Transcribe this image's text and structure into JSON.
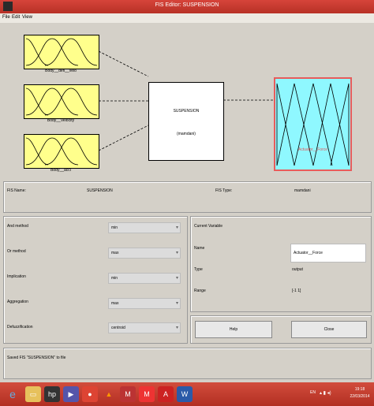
{
  "window": {
    "title": "FIS Editor: SUSPENSION"
  },
  "menu": [
    "File",
    "Edit",
    "View"
  ],
  "diagram": {
    "inputs": [
      "Body__defl__velo",
      "Body__Velocity",
      "Body__accl"
    ],
    "system_name": "SUSPENSION",
    "system_type": "(mamdani)",
    "output": "Actuator__Force"
  },
  "info": {
    "fis_name_label": "FIS Name:",
    "fis_name_value": "SUSPENSION",
    "fis_type_label": "FIS Type:",
    "fis_type_value": "mamdani"
  },
  "methods": [
    {
      "label": "And method",
      "value": "min"
    },
    {
      "label": "Or method",
      "value": "max"
    },
    {
      "label": "Implication",
      "value": "min"
    },
    {
      "label": "Aggregation",
      "value": "max"
    },
    {
      "label": "Defuzzification",
      "value": "centroid"
    }
  ],
  "current_variable": {
    "heading": "Current Variable",
    "name_label": "Name",
    "name_value": "Actuator__Force",
    "type_label": "Type",
    "type_value": "output",
    "range_label": "Range",
    "range_value": "[-1 1]"
  },
  "buttons": {
    "help": "Help",
    "close": "Close"
  },
  "status": {
    "message": "Saved FIS \"SUSPENSION\" to file"
  },
  "taskbar": {
    "lang": "EN",
    "time": "19:18",
    "date": "22/03/2014"
  },
  "colors": {
    "titlebar": "#c0392b",
    "input_mf_fill": "#ffff8c",
    "output_mf_fill": "#8ff8ff",
    "output_border": "#e85b5b",
    "output_label": "#e85b5b"
  }
}
